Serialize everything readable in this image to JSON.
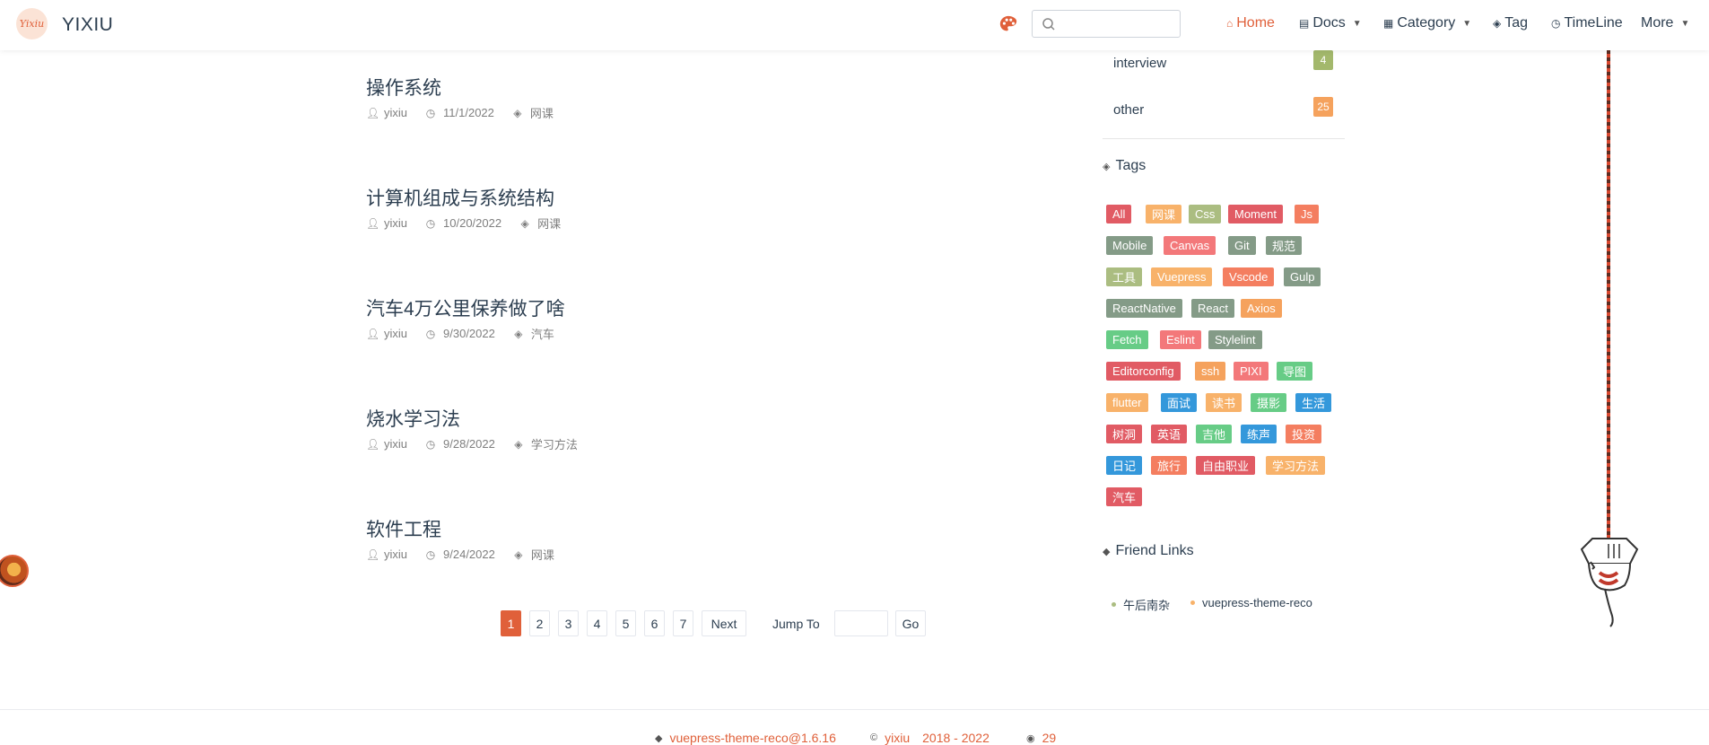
{
  "header": {
    "logo_text": "Yixiu",
    "site_name": "YIXIU",
    "search": {
      "value": "",
      "placeholder": ""
    },
    "nav": [
      {
        "label": "Home",
        "icon": "home-icon",
        "active": true
      },
      {
        "label": "Docs",
        "icon": "docs-icon",
        "dropdown": true
      },
      {
        "label": "Category",
        "icon": "category-icon",
        "dropdown": true
      },
      {
        "label": "Tag",
        "icon": "tag-icon"
      },
      {
        "label": "TimeLine",
        "icon": "clock-icon"
      },
      {
        "label": "More",
        "dropdown": true
      }
    ]
  },
  "articles": [
    {
      "title": "操作系统",
      "author": "yixiu",
      "date": "11/1/2022",
      "tag": "网课"
    },
    {
      "title": "计算机组成与系统结构",
      "author": "yixiu",
      "date": "10/20/2022",
      "tag": "网课"
    },
    {
      "title": "汽车4万公里保养做了啥",
      "author": "yixiu",
      "date": "9/30/2022",
      "tag": "汽车"
    },
    {
      "title": "烧水学习法",
      "author": "yixiu",
      "date": "9/28/2022",
      "tag": "学习方法"
    },
    {
      "title": "软件工程",
      "author": "yixiu",
      "date": "9/24/2022",
      "tag": "网课"
    }
  ],
  "pagination": {
    "pages": [
      "1",
      "2",
      "3",
      "4",
      "5",
      "6",
      "7"
    ],
    "current": "1",
    "next_label": "Next",
    "jump_label": "Jump To",
    "jump_value": "",
    "go_label": "Go"
  },
  "sidebar": {
    "categories": [
      {
        "name": "interview",
        "count": "4",
        "color": "#a3b86c"
      },
      {
        "name": "other",
        "count": "25",
        "color": "#f5a25d"
      }
    ],
    "tags_title": "Tags",
    "tags": [
      {
        "label": "All",
        "color": "#e15b64"
      },
      {
        "label": "网课",
        "color": "#f8b26a"
      },
      {
        "label": "Css",
        "color": "#abbd81"
      },
      {
        "label": "Moment",
        "color": "#e15b64"
      },
      {
        "label": "Js",
        "color": "#f47e60"
      },
      {
        "label": "Mobile",
        "color": "#849b87"
      },
      {
        "label": "Canvas",
        "color": "#f3787a"
      },
      {
        "label": "Git",
        "color": "#849b87"
      },
      {
        "label": "规范",
        "color": "#849b87"
      },
      {
        "label": "工具",
        "color": "#abbd81"
      },
      {
        "label": "Vuepress",
        "color": "#f8b26a"
      },
      {
        "label": "Vscode",
        "color": "#f47e60"
      },
      {
        "label": "Gulp",
        "color": "#849b87"
      },
      {
        "label": "ReactNative",
        "color": "#849b87"
      },
      {
        "label": "React",
        "color": "#849b87"
      },
      {
        "label": "Axios",
        "color": "#f5a25d"
      },
      {
        "label": "Fetch",
        "color": "#67cc86"
      },
      {
        "label": "Eslint",
        "color": "#f3787a"
      },
      {
        "label": "Stylelint",
        "color": "#849b87"
      },
      {
        "label": "Editorconfig",
        "color": "#e15b64"
      },
      {
        "label": "ssh",
        "color": "#f5a25d"
      },
      {
        "label": "PIXI",
        "color": "#f3787a"
      },
      {
        "label": "导图",
        "color": "#67cc86"
      },
      {
        "label": "flutter",
        "color": "#f8b26a"
      },
      {
        "label": "面试",
        "color": "#3498db"
      },
      {
        "label": "读书",
        "color": "#f8b26a"
      },
      {
        "label": "摄影",
        "color": "#67cc86"
      },
      {
        "label": "生活",
        "color": "#3498db"
      },
      {
        "label": "树洞",
        "color": "#e15b64"
      },
      {
        "label": "英语",
        "color": "#e15b64"
      },
      {
        "label": "吉他",
        "color": "#67cc86"
      },
      {
        "label": "练声",
        "color": "#3498db"
      },
      {
        "label": "投资",
        "color": "#f47e60"
      },
      {
        "label": "日记",
        "color": "#3498db"
      },
      {
        "label": "旅行",
        "color": "#f47e60"
      },
      {
        "label": "自由职业",
        "color": "#e15b64"
      },
      {
        "label": "学习方法",
        "color": "#f8b26a"
      },
      {
        "label": "汽车",
        "color": "#e15b64"
      }
    ],
    "friends_title": "Friend Links",
    "friends": [
      {
        "label": "午后南杂",
        "color": "#abbd81"
      },
      {
        "label": "vuepress-theme-reco",
        "color": "#f8b26a"
      }
    ]
  },
  "footer": {
    "theme": "vuepress-theme-reco@1.6.16",
    "author": "yixiu",
    "years": "2018 - 2022",
    "views": "29"
  },
  "colors": {
    "accent": "#e0603a",
    "text": "#2c3e50",
    "meta": "#7f7f7f"
  }
}
